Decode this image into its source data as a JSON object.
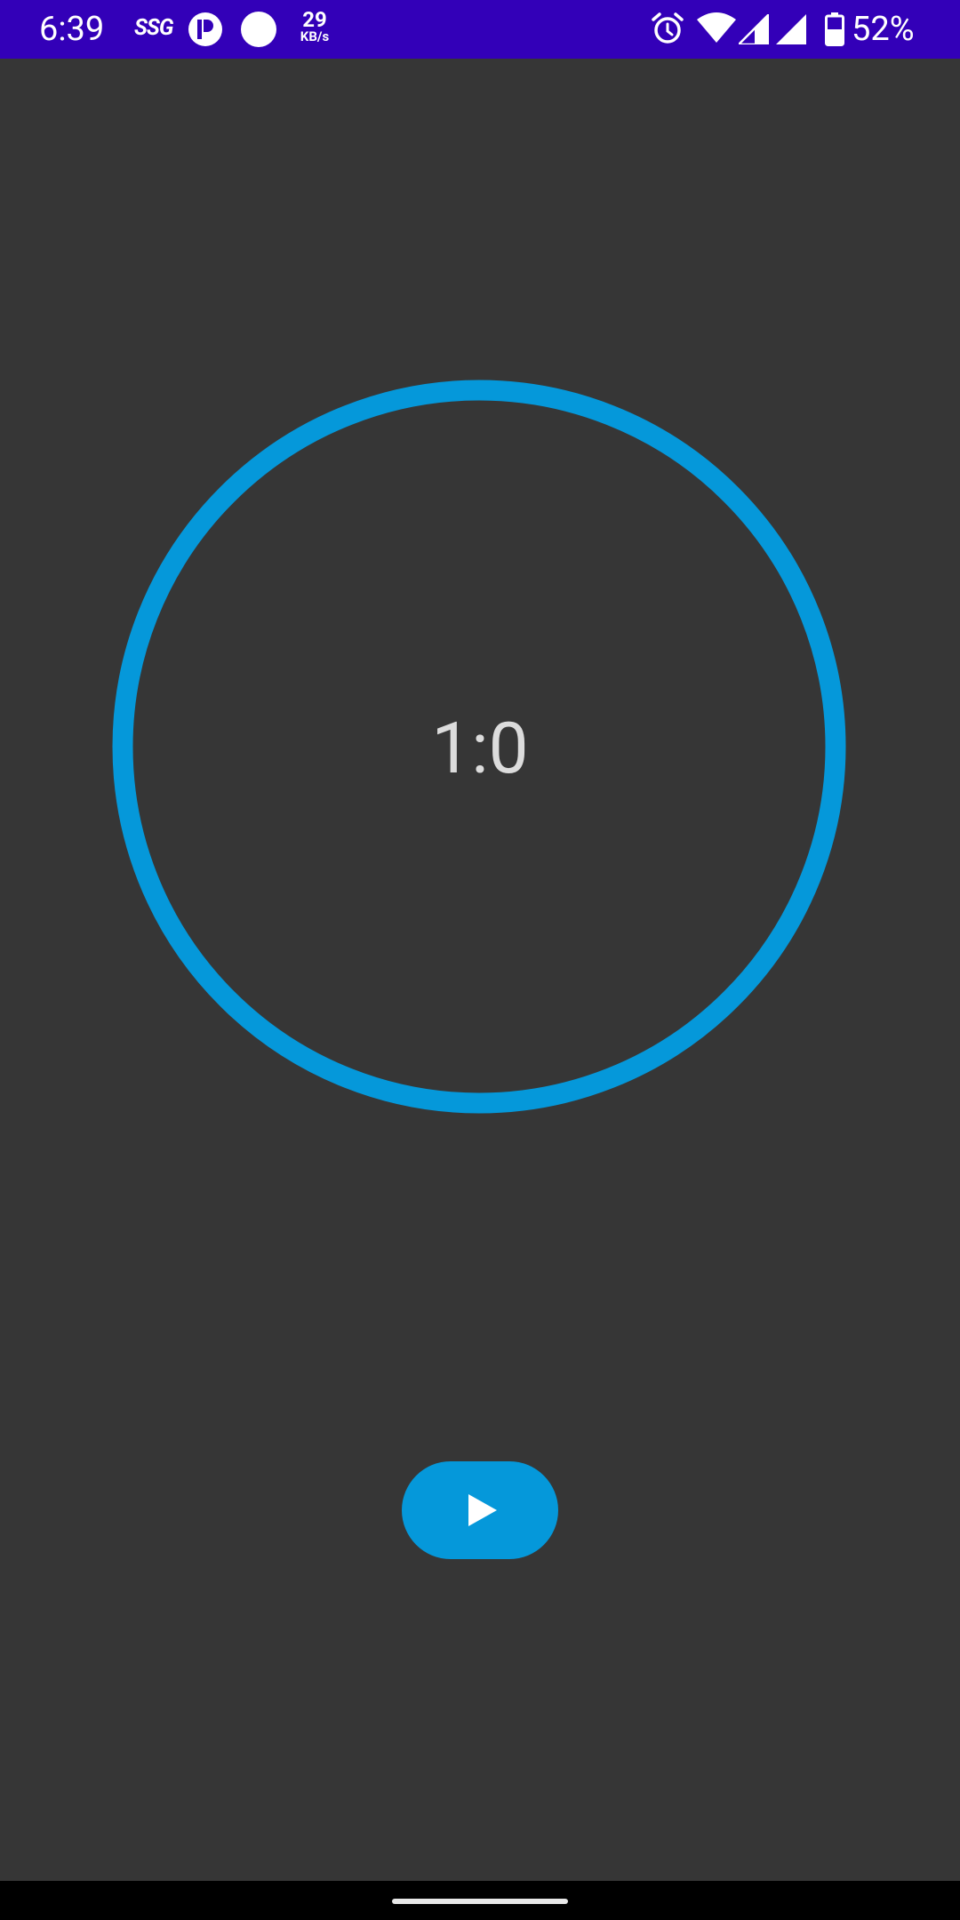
{
  "status_bar": {
    "time": "6:39",
    "carrier_label": "SSG",
    "net_speed_value": "29",
    "net_speed_unit": "KB/s",
    "battery_percent": "52%",
    "icons": [
      "r-app-icon",
      "circle-notification-icon",
      "alarm-icon",
      "wifi-icon",
      "cell-signal-icon",
      "cell-signal-icon",
      "battery-icon"
    ],
    "background_color": "#3300b8"
  },
  "timer": {
    "display": "1:0",
    "ring_color": "#0598da",
    "progress": 1.0
  },
  "controls": {
    "play_icon": "play-icon",
    "button_color": "#0598da"
  },
  "colors": {
    "background": "#363636"
  }
}
